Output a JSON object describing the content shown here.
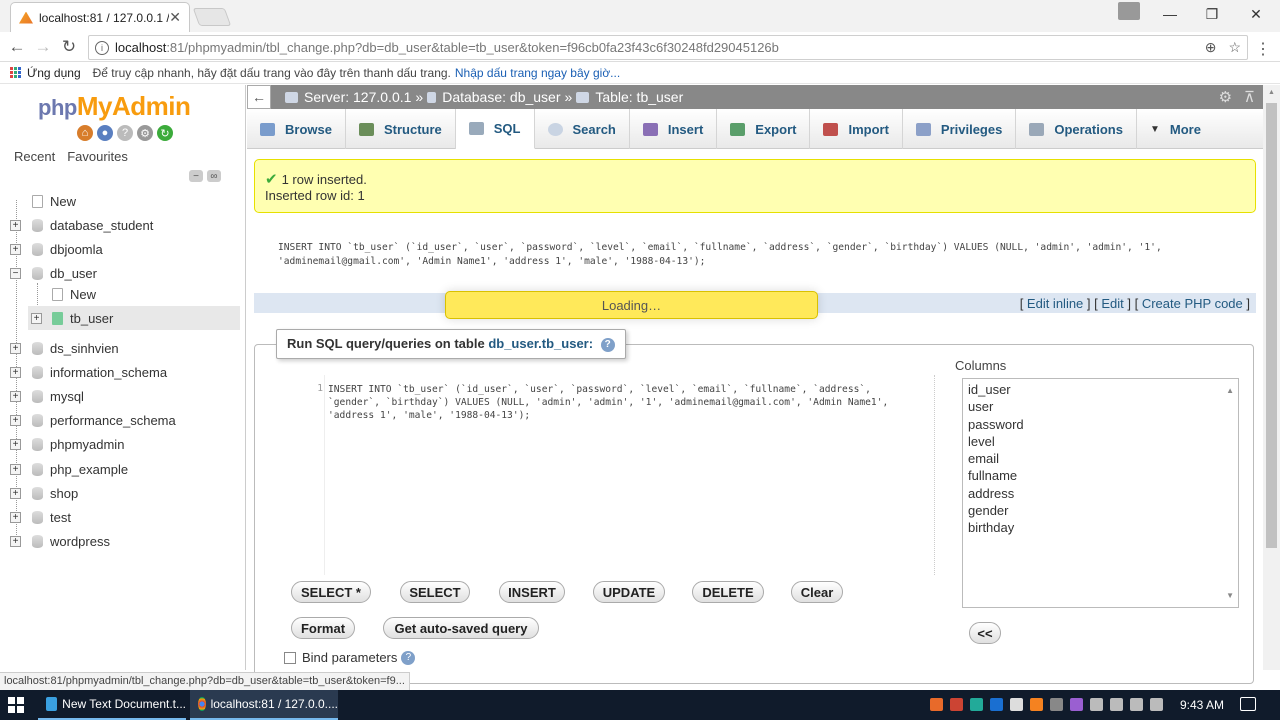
{
  "browser": {
    "tab_title": "localhost:81 / 127.0.0.1 /",
    "url_host": "localhost",
    "url_rest": ":81/phpmyadmin/tbl_change.php?db=db_user&table=tb_user&token=f96cb0fa23f43c6f30248fd29045126b",
    "bookmarks_apps": "Ứng dụng",
    "bookmarks_hint": "Để truy cập nhanh, hãy đặt dấu trang vào đây trên thanh dấu trang.",
    "bookmarks_link": "Nhập dấu trang ngay bây giờ...",
    "status_url": "localhost:81/phpmyadmin/tbl_change.php?db=db_user&table=tb_user&token=f9..."
  },
  "sidebar": {
    "logo_php": "php",
    "logo_myadmin": "MyAdmin",
    "tab_recent": "Recent",
    "tab_favourites": "Favourites",
    "tree": [
      {
        "label": "New"
      },
      {
        "label": "database_student"
      },
      {
        "label": "dbjoomla"
      },
      {
        "label": "db_user"
      },
      {
        "label": "New"
      },
      {
        "label": "tb_user"
      },
      {
        "label": "ds_sinhvien"
      },
      {
        "label": "information_schema"
      },
      {
        "label": "mysql"
      },
      {
        "label": "performance_schema"
      },
      {
        "label": "phpmyadmin"
      },
      {
        "label": "php_example"
      },
      {
        "label": "shop"
      },
      {
        "label": "test"
      },
      {
        "label": "wordpress"
      }
    ]
  },
  "breadcrumb": {
    "server": "Server: 127.0.0.1",
    "database": "Database: db_user",
    "table": "Table: tb_user"
  },
  "tabs": [
    "Browse",
    "Structure",
    "SQL",
    "Search",
    "Insert",
    "Export",
    "Import",
    "Privileges",
    "Operations",
    "More"
  ],
  "message": {
    "line1": "1 row inserted.",
    "line2": "Inserted row id: 1"
  },
  "sql_display": {
    "line1": "INSERT INTO `tb_user` (`id_user`, `user`, `password`, `level`, `email`, `fullname`, `address`, `gender`, `birthday`) VALUES (NULL, 'admin', 'admin', '1',",
    "line2": "'adminemail@gmail.com', 'Admin Name1', 'address 1', 'male', '1988-04-13');"
  },
  "edit_links": {
    "edit_inline": "Edit inline",
    "edit": "Edit",
    "create_php": "Create PHP code"
  },
  "loading": "Loading…",
  "query_box": {
    "legend_prefix": "Run SQL query/queries on table",
    "legend_table": "db_user.tb_user:",
    "line_no": "1",
    "code_line1": "INSERT INTO `tb_user` (`id_user`, `user`, `password`, `level`, `email`, `fullname`, `address`,",
    "code_line2": "`gender`, `birthday`) VALUES (NULL, 'admin', 'admin', '1', 'adminemail@gmail.com', 'Admin Name1',",
    "code_line3": "'address 1', 'male', '1988-04-13');",
    "columns_label": "Columns",
    "columns": [
      "id_user",
      "user",
      "password",
      "level",
      "email",
      "fullname",
      "address",
      "gender",
      "birthday"
    ],
    "insert_cols_btn": "<<",
    "buttons": [
      "SELECT *",
      "SELECT",
      "INSERT",
      "UPDATE",
      "DELETE",
      "Clear"
    ],
    "format_btn": "Format",
    "autosaved_btn": "Get auto-saved query",
    "bind_params": "Bind parameters"
  },
  "taskbar": {
    "task1": "New Text Document.t...",
    "task2": "localhost:81 / 127.0.0....",
    "clock": "9:43 AM"
  }
}
